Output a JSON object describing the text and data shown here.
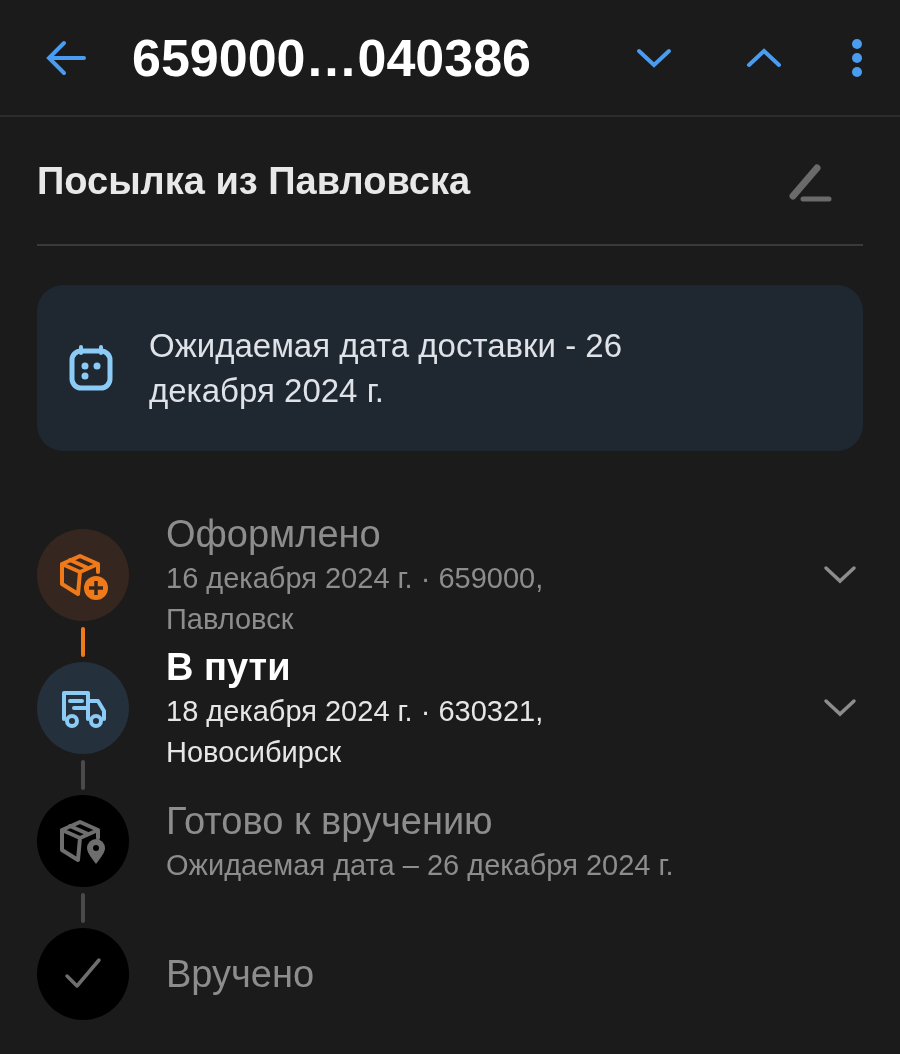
{
  "header": {
    "title": "659000…040386"
  },
  "parcel": {
    "name": "Посылка из Павловска"
  },
  "delivery_card": {
    "text": "Ожидаемая дата доставки - 26 декабря 2024 г."
  },
  "steps": [
    {
      "kind": "created",
      "completed": true,
      "current": false,
      "title": "Оформлено",
      "details": "16 декабря 2024 г. · 659000, Павловск",
      "expanded": false
    },
    {
      "kind": "transit",
      "completed": false,
      "current": true,
      "title": "В пути",
      "details": "18 декабря 2024 г. · 630321, Новосибирск",
      "expanded": false
    },
    {
      "kind": "ready",
      "completed": false,
      "current": false,
      "title": "Готово к вручению",
      "details": "Ожидаемая дата – 26 декабря 2024 г."
    },
    {
      "kind": "delivered",
      "completed": false,
      "current": false,
      "title": "Вручено"
    }
  ]
}
